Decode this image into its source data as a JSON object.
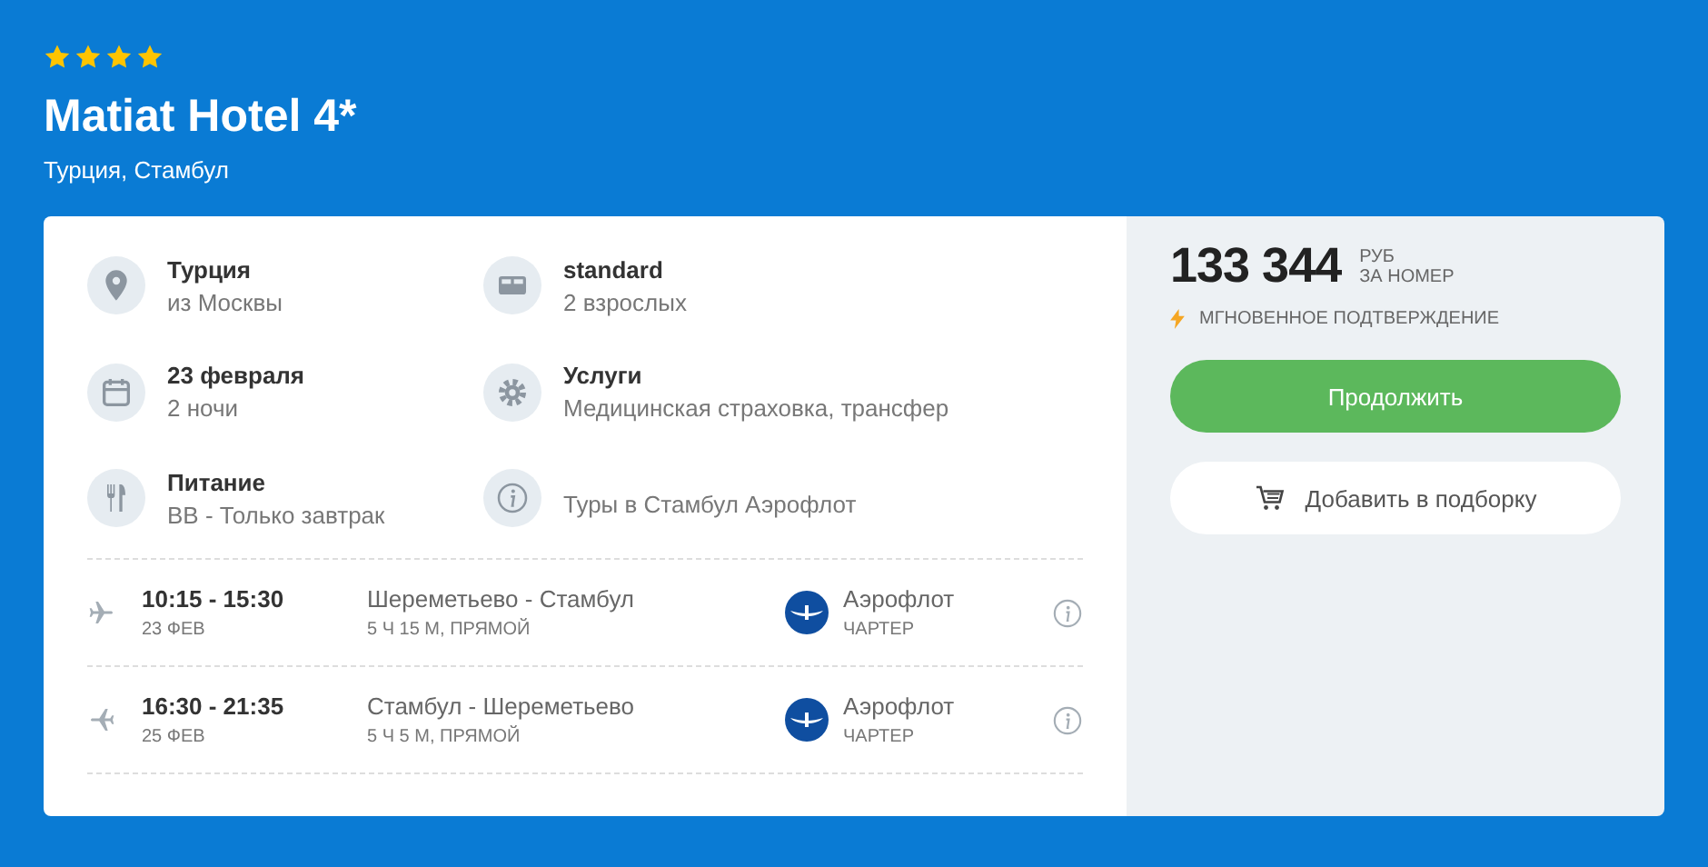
{
  "hotel": {
    "stars": 4,
    "name": "Matiat Hotel 4*",
    "location": "Турция, Стамбул"
  },
  "details": [
    {
      "kind": "location",
      "title": "Турция",
      "text": "из Москвы"
    },
    {
      "kind": "bed",
      "title": "standard",
      "text": "2 взрослых"
    },
    {
      "kind": "calendar",
      "title": "23 февраля",
      "text": "2 ночи"
    },
    {
      "kind": "gear",
      "title": "Услуги",
      "text": "Медицинская страховка, трансфер"
    },
    {
      "kind": "food",
      "title": "Питание",
      "text": "BB - Только завтрак"
    },
    {
      "kind": "info",
      "text": "Туры в Стамбул Аэрофлот"
    }
  ],
  "flights": [
    {
      "kind": "outbound",
      "time": "10:15 - 15:30",
      "date": "23 ФЕВ",
      "route": "Шереметьево - Стамбул",
      "duration": "5 Ч 15 М, ПРЯМОЙ",
      "airline": "Аэрофлот",
      "type": "ЧАРТЕР"
    },
    {
      "kind": "return",
      "time": "16:30 - 21:35",
      "date": "25 ФЕВ",
      "route": "Стамбул - Шереметьево",
      "duration": "5 Ч 5 М, ПРЯМОЙ",
      "airline": "Аэрофлот",
      "type": "ЧАРТЕР"
    }
  ],
  "price": {
    "amount": "133 344",
    "currency": "РУБ",
    "unit": "ЗА НОМЕР",
    "note": "МГНОВЕННОЕ ПОДТВЕРЖДЕНИЕ"
  },
  "buttons": {
    "primary": "Продолжить",
    "secondary": "Добавить в подборку"
  }
}
